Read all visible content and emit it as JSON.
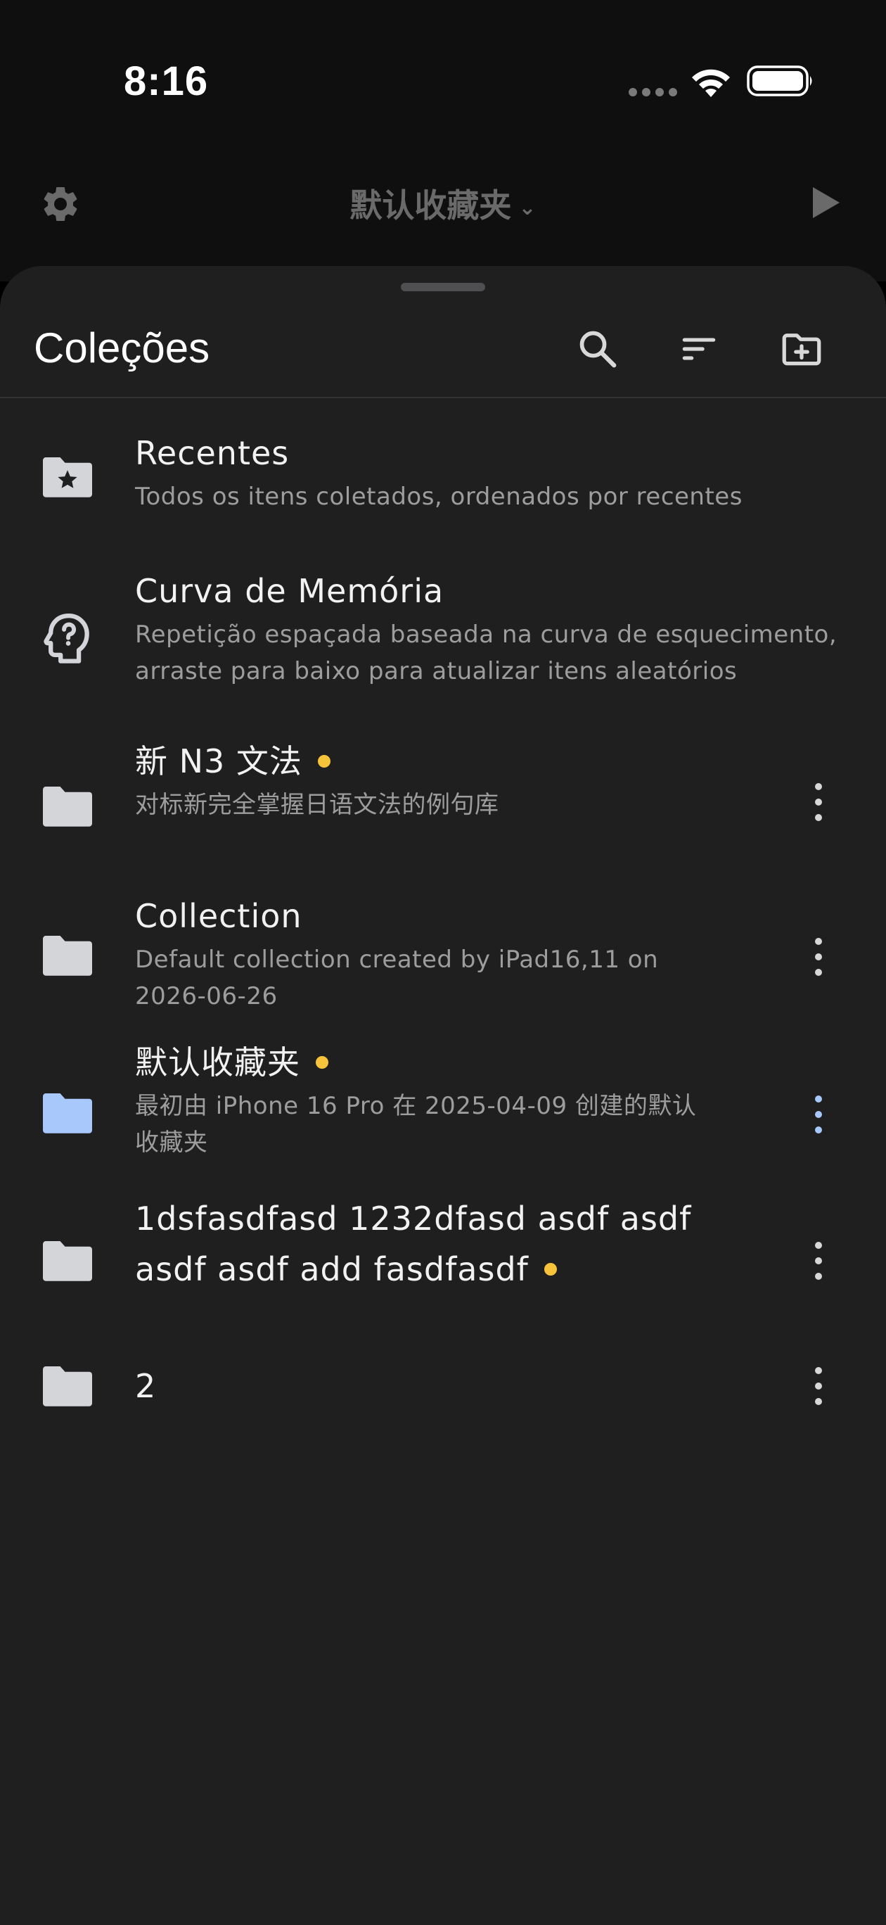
{
  "status_bar": {
    "time": "8:16"
  },
  "header": {
    "title": "默认收藏夹"
  },
  "sheet": {
    "title": "Coleções"
  },
  "colors": {
    "accent_dot": "#f7c33b",
    "folder_default": "#d4d5d9",
    "folder_selected": "#a8c7fa",
    "more_selected": "#a8c7fa"
  },
  "items": [
    {
      "title": "Recentes",
      "subtitle": "Todos os itens coletados, ordenados por recentes",
      "icon": "folder-star-icon"
    },
    {
      "title": "Curva de Memória",
      "subtitle_line1": "Repetição espaçada baseada na curva de esquecimento,",
      "subtitle_line2": "arraste para baixo para atualizar itens aleatórios",
      "icon": "brain-question-icon"
    },
    {
      "title": "新 N3 文法",
      "subtitle": "对标新完全掌握日语文法的例句库",
      "icon": "folder-icon",
      "has_dot": true
    },
    {
      "title": "Collection",
      "subtitle_line1": "Default collection created by iPad16,11 on",
      "subtitle_line2": "2026-06-26",
      "icon": "folder-icon"
    },
    {
      "title": "默认收藏夹",
      "subtitle_line1": "最初由 iPhone 16 Pro 在 2025-04-09 创建的默认",
      "subtitle_line2": "收藏夹",
      "icon": "folder-icon",
      "selected": true,
      "has_dot": true
    },
    {
      "title_line1": "1dsfasdfasd 1232dfasd asdf asdf",
      "title_line2": "asdf asdf add fasdfasdf",
      "icon": "folder-icon",
      "has_dot": true
    },
    {
      "title": "2",
      "icon": "folder-icon"
    }
  ]
}
